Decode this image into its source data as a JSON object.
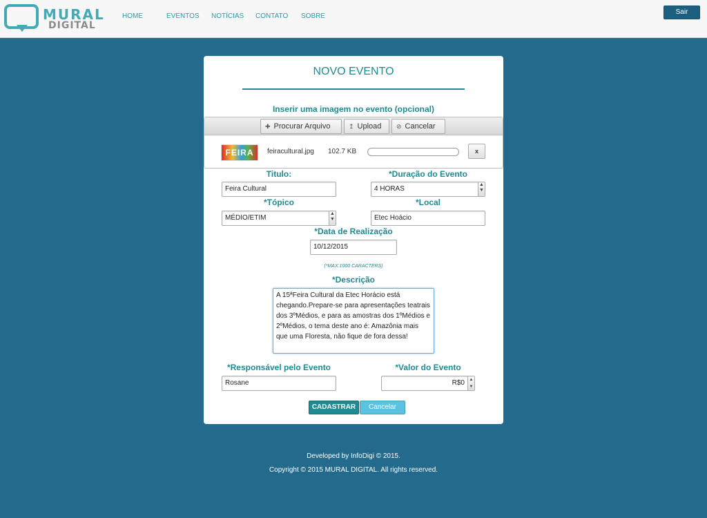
{
  "header": {
    "logo_line1": "MURAL",
    "logo_line2": "DIGITAL",
    "nav": [
      "HOME",
      "EVENTOS",
      "NOTÍCIAS",
      "CONTATO",
      "SOBRE"
    ],
    "logout_label": "Sair"
  },
  "form": {
    "title": "NOVO EVENTO",
    "upload": {
      "label": "Inserir uma imagem no evento (opcional)",
      "browse_label": "Procurar Arquivo",
      "upload_label": "Upload",
      "cancel_label": "Cancelar",
      "thumb_text": "FEIRA",
      "file_name": "feiracultural.jpg",
      "file_size": "102.7 KB",
      "progress": 0,
      "remove_icon": "x"
    },
    "titulo": {
      "label": "Titulo:",
      "value": "Feira Cultural"
    },
    "duracao": {
      "label": "*Duração do Evento",
      "value": "4 HORAS"
    },
    "topico": {
      "label": "*Tópico",
      "value": "MÉDIO/ETIM"
    },
    "local": {
      "label": "*Local",
      "value": "Etec Hoácio"
    },
    "data": {
      "label": "*Data de Realização",
      "value": "10/12/2015"
    },
    "max_chars_note": "(*MAX.1000 CARACTERS)",
    "descricao": {
      "label": "*Descrição",
      "value": "A 15ªFeira Cultural da Etec Horácio está chegando.Prepare-se para apresentações teatrais dos 3ºMédios, e para as amostras dos 1ºMédios e 2ºMédios, o tema deste ano é: Amazônia mais que uma Floresta, não fique de fora dessa!"
    },
    "responsavel": {
      "label": "*Responsável pelo Evento",
      "value": "Rosane"
    },
    "valor": {
      "label": "*Valor do Evento",
      "value": "R$0"
    },
    "submit_label": "CADASTRAR",
    "cancel_label": "Cancelar"
  },
  "footer": {
    "line1": "Developed by InfoDigi © 2015.",
    "line2": "Copyright © 2015 MURAL DIGITAL. All rights reserved."
  },
  "colors": {
    "background": "#236a8c",
    "accent": "#1e8a91",
    "header_bg": "#f7f7f7"
  }
}
